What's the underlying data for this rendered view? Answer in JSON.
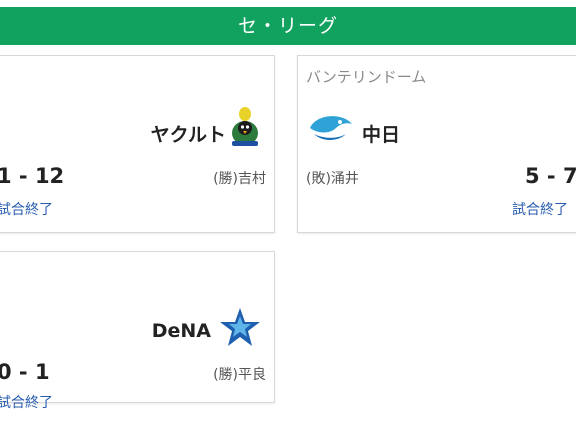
{
  "league": {
    "title": "セ・リーグ"
  },
  "colors": {
    "header_bg": "#12a260",
    "link": "#2a5db0",
    "text": "#222222",
    "muted": "#8a8a8a"
  },
  "games": [
    {
      "team": "ヤクルト",
      "team_logo": "swallows-logo-icon",
      "score": "1 - 12",
      "status": "試合終了",
      "pitcher": "(勝)吉村"
    },
    {
      "venue": "バンテリンドーム",
      "team": "中日",
      "team_logo": "dragons-logo-icon",
      "score": "5 - 7",
      "status": "試合終了",
      "pitcher": "(敗)涌井"
    },
    {
      "team": "DeNA",
      "team_logo": "baystars-logo-icon",
      "score": "0 - 1",
      "status": "試合終了",
      "pitcher": "(勝)平良"
    }
  ]
}
